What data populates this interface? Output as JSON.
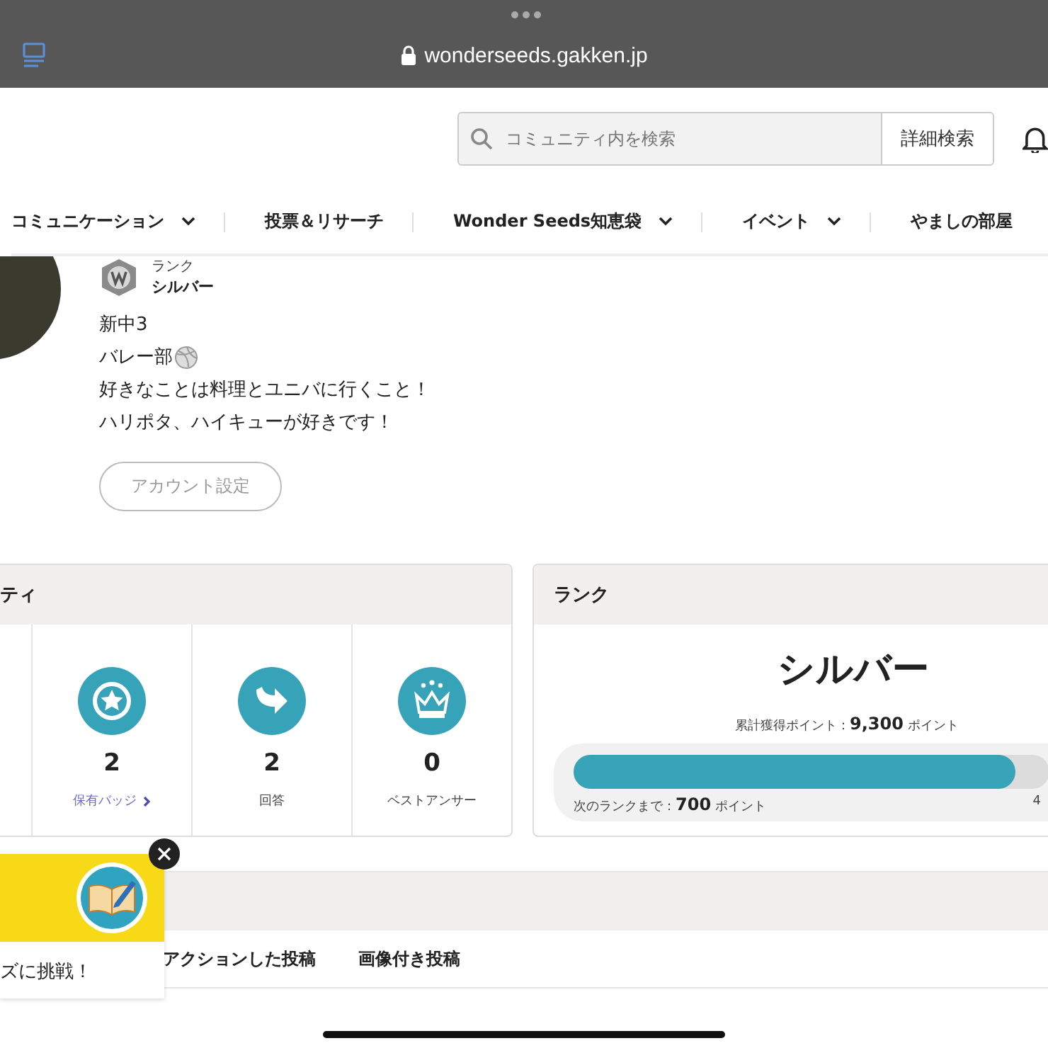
{
  "browser": {
    "url": "wonderseeds.gakken.jp"
  },
  "header": {
    "search": {
      "placeholder": "コミュニティ内を検索"
    },
    "advanced_search": "詳細検索"
  },
  "nav": [
    {
      "label": "コミュニケーション",
      "dropdown": true
    },
    {
      "label": "投票＆リサーチ",
      "dropdown": false
    },
    {
      "label": "Wonder Seeds知恵袋",
      "dropdown": true
    },
    {
      "label": "イベント",
      "dropdown": true
    },
    {
      "label": "やましの部屋",
      "dropdown": false
    }
  ],
  "profile": {
    "rank_label": "ランク",
    "rank": "シルバー",
    "bio": [
      "新中3",
      "バレー部",
      "好きなことは料理とユニバに行くこと！",
      "ハリポタ、ハイキューが好きです！"
    ],
    "account_button": "アカウント設定"
  },
  "activity_card": {
    "title": "ティ",
    "stats": [
      {
        "kind": "badge",
        "value": "2",
        "label": "保有バッジ",
        "link": true
      },
      {
        "kind": "answer",
        "value": "2",
        "label": "回答",
        "link": false
      },
      {
        "kind": "best",
        "value": "0",
        "label": "ベストアンサー",
        "link": false
      }
    ]
  },
  "rank_card": {
    "title": "ランク",
    "rank": "シルバー",
    "total_label": "累計獲得ポイント：",
    "total": "9,300",
    "total_unit": "ポイント",
    "level": 0.93,
    "next_label": "次のランクまで：",
    "next": "700",
    "next_unit": "ポイント",
    "right_value": "4"
  },
  "posts_tabs": [
    {
      "label": "アクションした投稿"
    },
    {
      "label": "画像付き投稿"
    }
  ],
  "popup": {
    "text": "ズに挑戦！"
  }
}
